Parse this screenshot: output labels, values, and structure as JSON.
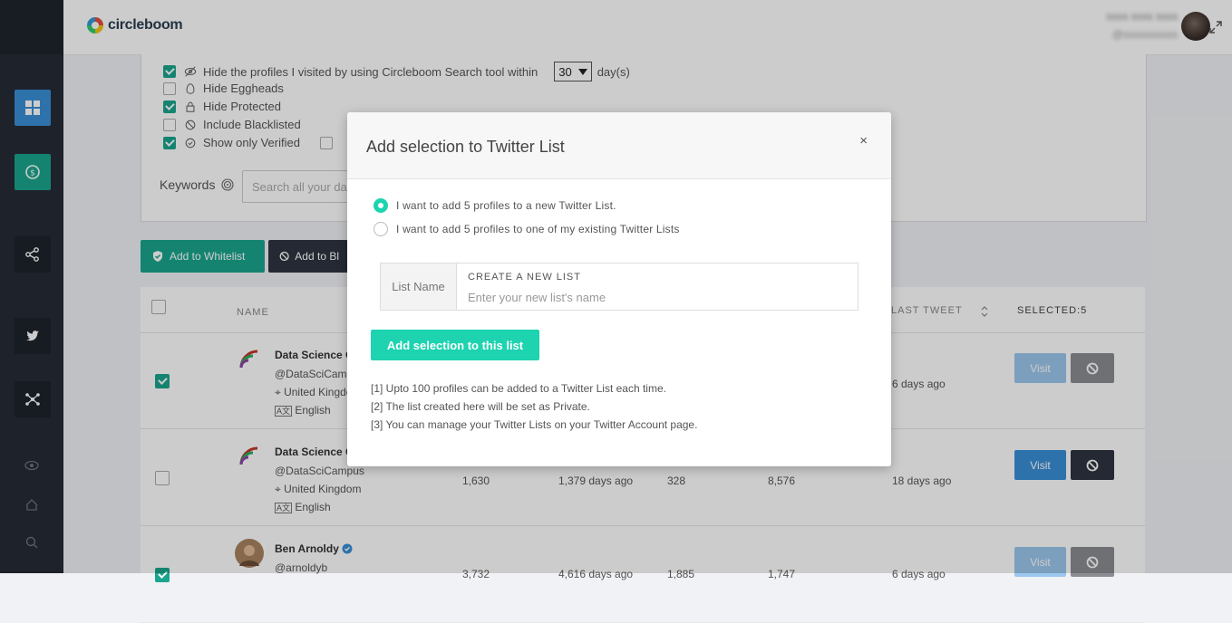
{
  "app": {
    "logo_text": "circleboom",
    "user_name": "ssss ssss ssss",
    "user_handle": "@ssssssssss"
  },
  "filters": {
    "items": [
      {
        "label": "Hide the profiles I visited by using Circleboom Search tool within",
        "checked": true,
        "icon": "eye-slash-icon"
      },
      {
        "label": "Hide Eggheads",
        "checked": false,
        "icon": "egg-icon"
      },
      {
        "label": "Hide Protected",
        "checked": true,
        "icon": "lock-icon"
      },
      {
        "label": "Include Blacklisted",
        "checked": false,
        "icon": "ban-icon"
      },
      {
        "label": "Show only Verified",
        "checked": true,
        "icon": "badge-check-icon"
      }
    ],
    "days_value": "30",
    "days_suffix": "day(s)",
    "keywords_label": "Keywords",
    "keywords_placeholder": "Search all your data"
  },
  "actions": {
    "whitelist_label": "Add to Whitelist",
    "blacklist_label": "Add to Bl"
  },
  "table": {
    "headers": {
      "name": "NAME",
      "last_tweet": "LAST TWEET",
      "selected": "SELECTED:5"
    },
    "rows": [
      {
        "checked": true,
        "name": "Data Science C",
        "handle": "@DataSciCamp",
        "location": "United Kingdo",
        "language": "English",
        "followers": "",
        "account_age": "",
        "following": "",
        "tweets": "",
        "last_tweet": "6 days ago",
        "faded": true
      },
      {
        "checked": false,
        "name": "Data Science C",
        "handle": "@DataSciCampus",
        "location": "United Kingdom",
        "language": "English",
        "followers": "1,630",
        "account_age": "1,379 days ago",
        "following": "328",
        "tweets": "8,576",
        "last_tweet": "18 days ago",
        "faded": false
      },
      {
        "checked": true,
        "name": "Ben Arnoldy",
        "handle": "@arnoldyb",
        "location": "",
        "language": "",
        "followers": "3,732",
        "account_age": "4,616 days ago",
        "following": "1,885",
        "tweets": "1,747",
        "last_tweet": "6 days ago",
        "faded": true
      }
    ],
    "visit_label": "Visit"
  },
  "modal": {
    "title": "Add selection to Twitter List",
    "close": "×",
    "options": [
      {
        "label": "I want to add 5 profiles to a new Twitter List.",
        "selected": true
      },
      {
        "label": "I want to add 5 profiles to one of my existing Twitter Lists",
        "selected": false
      }
    ],
    "list_name_label": "List Name",
    "create_label": "CREATE A NEW LIST",
    "list_placeholder": "Enter your new list's name",
    "submit_label": "Add selection to this list",
    "notes": [
      "[1] Upto 100 profiles can be added to a Twitter List each time.",
      "[2] The list created here will be set as Private.",
      "[3] You can manage your Twitter Lists on your Twitter Account page."
    ]
  },
  "colors": {
    "teal": "#1aa58e",
    "modal_accent": "#1dd3b0",
    "blue": "#3a8fd8",
    "sidebar": "#252b36"
  }
}
